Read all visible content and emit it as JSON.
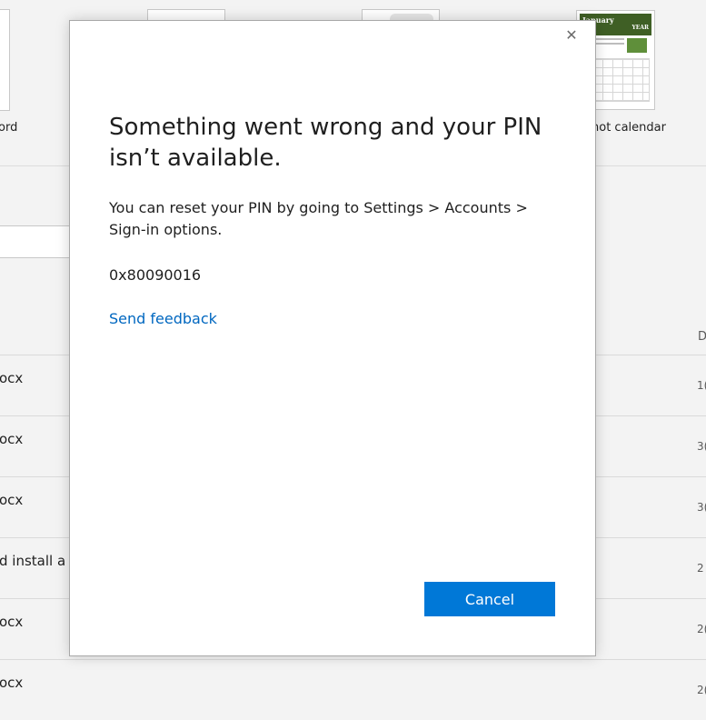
{
  "background": {
    "templates": [
      {
        "name": "blank-document",
        "label": "ord"
      },
      {
        "name": "snapshot-calendar",
        "label": "hot calendar",
        "thumb_month": "January",
        "thumb_year": "YEAR"
      }
    ],
    "column_header": "D",
    "files": [
      {
        "name": "ocx",
        "date": "1("
      },
      {
        "name": "ocx",
        "date": "3("
      },
      {
        "name": "ocx",
        "date": "3("
      },
      {
        "name": "d install a",
        "date": "2"
      },
      {
        "name": "ocx",
        "date": "2("
      },
      {
        "name": "ocx",
        "date": "2("
      }
    ]
  },
  "dialog": {
    "close_glyph": "✕",
    "title": "Something went wrong and your PIN isn’t available.",
    "message": "You can reset your PIN by going to Settings > Accounts > Sign-in options.",
    "error_code": "0x80090016",
    "feedback_link": "Send feedback",
    "cancel_label": "Cancel"
  },
  "colors": {
    "accent": "#0078d7",
    "link": "#0067c0",
    "calendar_header": "#3f5f25"
  }
}
